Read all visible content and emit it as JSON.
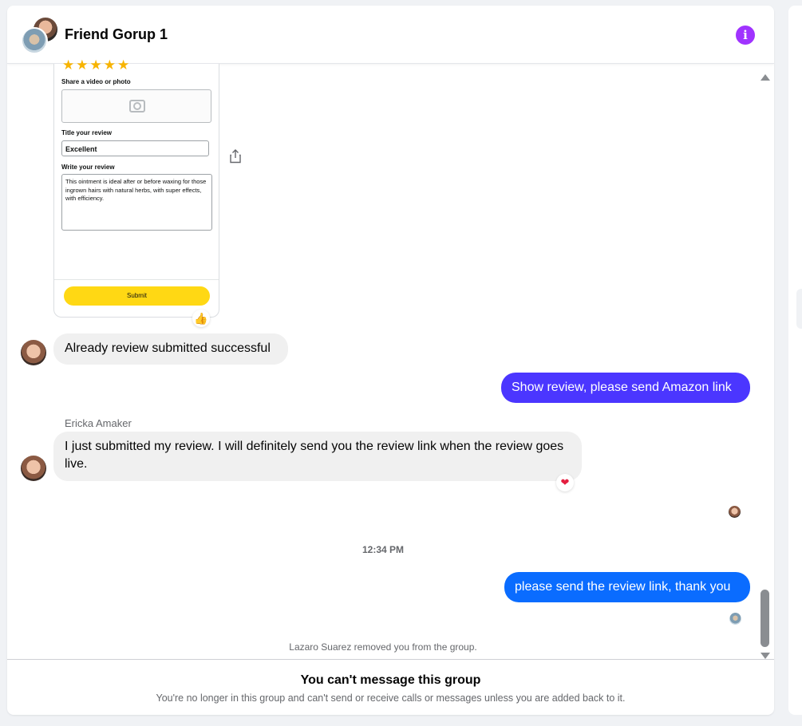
{
  "header": {
    "title": "Friend Gorup 1",
    "info_icon": "info-icon",
    "info_glyph": "i"
  },
  "review_card": {
    "rating_stars": 5,
    "stars": "★★★★★",
    "share_label": "Share a video or photo",
    "title_label": "Title your review",
    "title_value": "Excellent",
    "review_label": "Write your review",
    "review_text": "This ointment is ideal after or before waxing for those ingrown hairs with natural herbs, with super effects, with efficiency.",
    "submit_label": "Submit",
    "reaction": "👍"
  },
  "messages": [
    {
      "type": "incoming",
      "text": "Already review submitted successful"
    },
    {
      "type": "outgoing",
      "text": "Show review, please send Amazon link",
      "color": "#4b36ff"
    },
    {
      "type": "incoming",
      "sender": "Ericka Amaker",
      "text": "I just submitted my review. I will definitely send you the review link when the review goes live.",
      "reaction": "❤"
    },
    {
      "type": "timestamp",
      "text": "12:34 PM"
    },
    {
      "type": "outgoing",
      "text": "please send the review link, thank you",
      "color": "#0a6cff"
    },
    {
      "type": "system",
      "text": "Lazaro Suarez removed you from the group."
    }
  ],
  "footer": {
    "title": "You can't message this group",
    "subtitle": "You're no longer in this group and can't send or receive calls or messages unless you are added back to it."
  },
  "colors": {
    "accent_purple": "#a033ff",
    "outgoing_1": "#4b36ff",
    "outgoing_2": "#0a6cff",
    "incoming_bg": "#f0f0f0"
  }
}
